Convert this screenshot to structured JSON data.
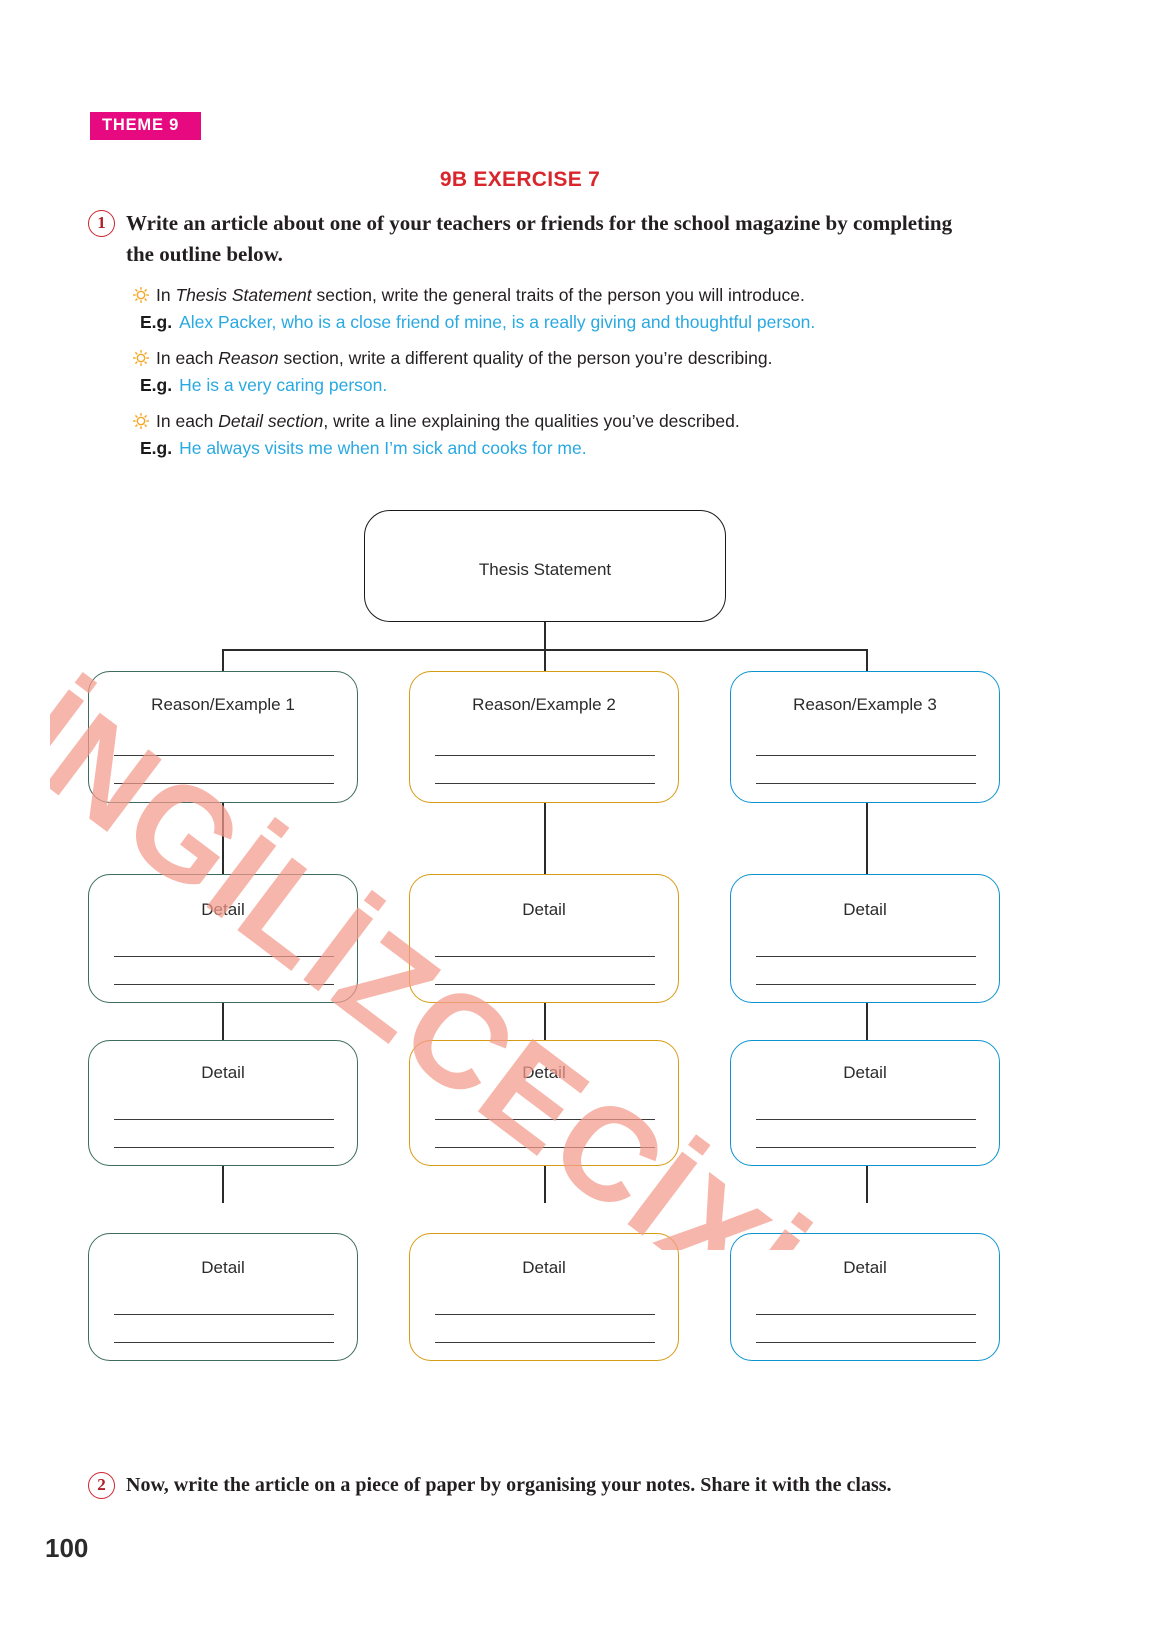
{
  "page": {
    "theme_badge": "THEME 9",
    "exercise_title": "9B EXERCISE 7",
    "page_number": "100",
    "watermark": "İNGİLİZCECİXİZ.COM",
    "colors": {
      "badge_bg": "#e6097f",
      "title_red": "#d8262c",
      "example_blue": "#29a9e1",
      "bullet_orange": "#f5a623",
      "column1": "#3d6b5e",
      "column2": "#d89b16",
      "column3": "#0d93cf",
      "thesis": "#1a1a1a"
    }
  },
  "tasks": [
    {
      "number": "1",
      "text": "Write an article about one of your teachers or friends for the school magazine by completing the outline below."
    },
    {
      "number": "2",
      "text": "Now, write the article on a piece of paper by organising your notes. Share it with the class."
    }
  ],
  "instructions": [
    {
      "bullet_icon": "sun-icon",
      "prefix": "In ",
      "emphasis": "Thesis Statement",
      "suffix": " section, write the general traits of the person you will introduce.",
      "eg_label": "E.g.",
      "eg_text": "Alex Packer, who is a close friend of mine, is a really giving and thoughtful person."
    },
    {
      "bullet_icon": "sun-icon",
      "prefix": "In each ",
      "emphasis": "Reason",
      "suffix": " section, write a different quality of the person you’re describing.",
      "eg_label": "E.g.",
      "eg_text": "He is a very caring person."
    },
    {
      "bullet_icon": "sun-icon",
      "prefix": "In each ",
      "emphasis": "Detail section",
      "suffix": ", write a line explaining the qualities you’ve described.",
      "eg_label": "E.g.",
      "eg_text": "He always visits me when I’m sick and cooks for me."
    }
  ],
  "diagram": {
    "thesis": {
      "label": "Thesis Statement"
    },
    "columns": [
      {
        "color": "#3d6b5e",
        "reason_label": "Reason/Example 1",
        "details": [
          "Detail",
          "Detail",
          "Detail"
        ]
      },
      {
        "color": "#d89b16",
        "reason_label": "Reason/Example 2",
        "details": [
          "Detail",
          "Detail",
          "Detail"
        ]
      },
      {
        "color": "#0d93cf",
        "reason_label": "Reason/Example 3",
        "details": [
          "Detail",
          "Detail",
          "Detail"
        ]
      }
    ],
    "lines_per_box": 2
  }
}
